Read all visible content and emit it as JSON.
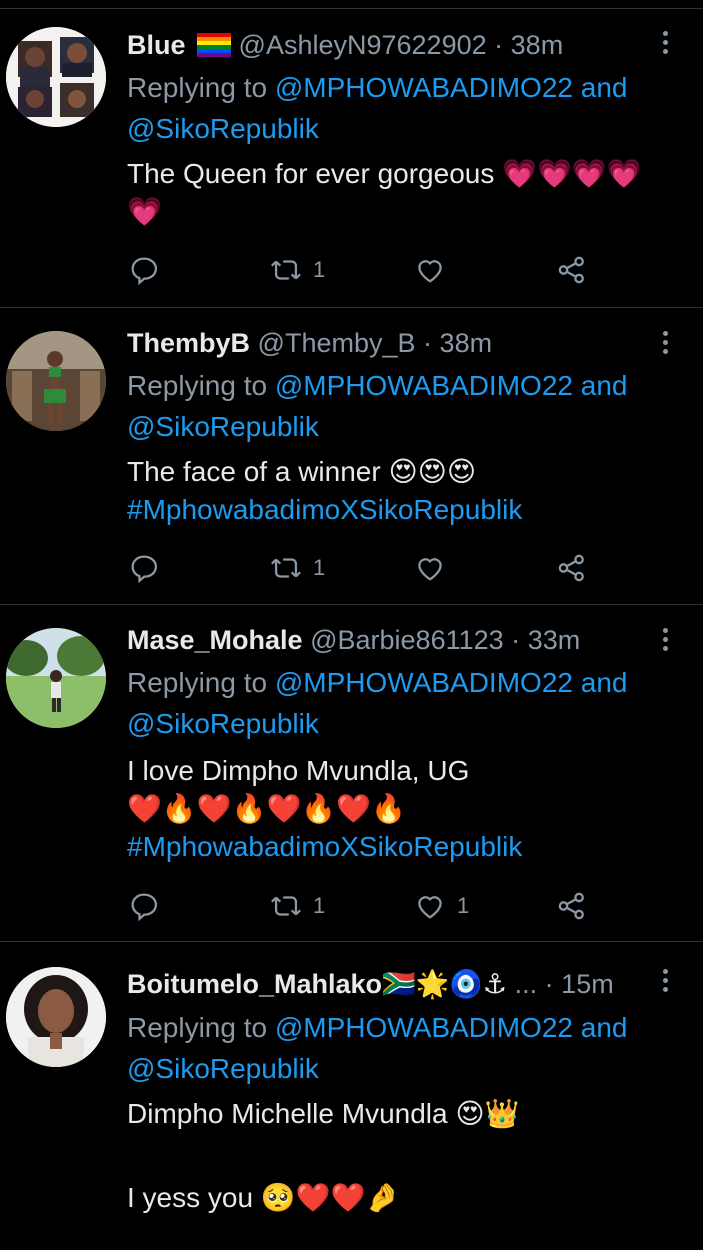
{
  "tweets": [
    {
      "name": "Blue",
      "flag_emoji": "🏳️‍🌈",
      "handle": "@AshleyN97622902",
      "time": "38m",
      "replying_prefix": "Replying to",
      "mention1": "@MPHOWABADIMO22",
      "and_word": "and",
      "mention2": "@SikoRepublik",
      "text_line1": "The Queen for ever gorgeous 💗💗💗💗",
      "text_line2": "💗",
      "retweets": "1",
      "likes": ""
    },
    {
      "name": "ThembyB",
      "handle": "@Themby_B",
      "time": "38m",
      "replying_prefix": "Replying to",
      "mention1": "@MPHOWABADIMO22",
      "and_word": "and",
      "mention2": "@SikoRepublik",
      "text_line1": "The face of a winner 😍😍😍",
      "hashtag": "#MphowabadimoXSikoRepublik",
      "retweets": "1",
      "likes": ""
    },
    {
      "name": "Mase_Mohale",
      "handle": "@Barbie861123",
      "time": "33m",
      "replying_prefix": "Replying to",
      "mention1": "@MPHOWABADIMO22",
      "and_word": "and",
      "mention2": "@SikoRepublik",
      "text_line1": "I love Dimpho Mvundla, UG",
      "text_line2": "❤️🔥❤️🔥❤️🔥❤️🔥",
      "hashtag": "#MphowabadimoXSikoRepublik",
      "retweets": "1",
      "likes": "1"
    },
    {
      "name": "Boitumelo_Mahlako🇿🇦🌟🧿⚓",
      "handle": "...",
      "time": "15m",
      "replying_prefix": "Replying to",
      "mention1": "@MPHOWABADIMO22",
      "and_word": "and",
      "mention2": "@SikoRepublik",
      "text_line1": "Dimpho Michelle Mvundla 😍👑",
      "text_line3": "I yess you 🥺❤️❤️🤌"
    }
  ],
  "icons": [
    "reply-icon",
    "retweet-icon",
    "like-icon",
    "share-icon",
    "more-icon"
  ],
  "colors": {
    "background": "#000000",
    "accent": "#1d9bf0",
    "muted": "#8b98a5",
    "text": "#e7e9ea"
  }
}
